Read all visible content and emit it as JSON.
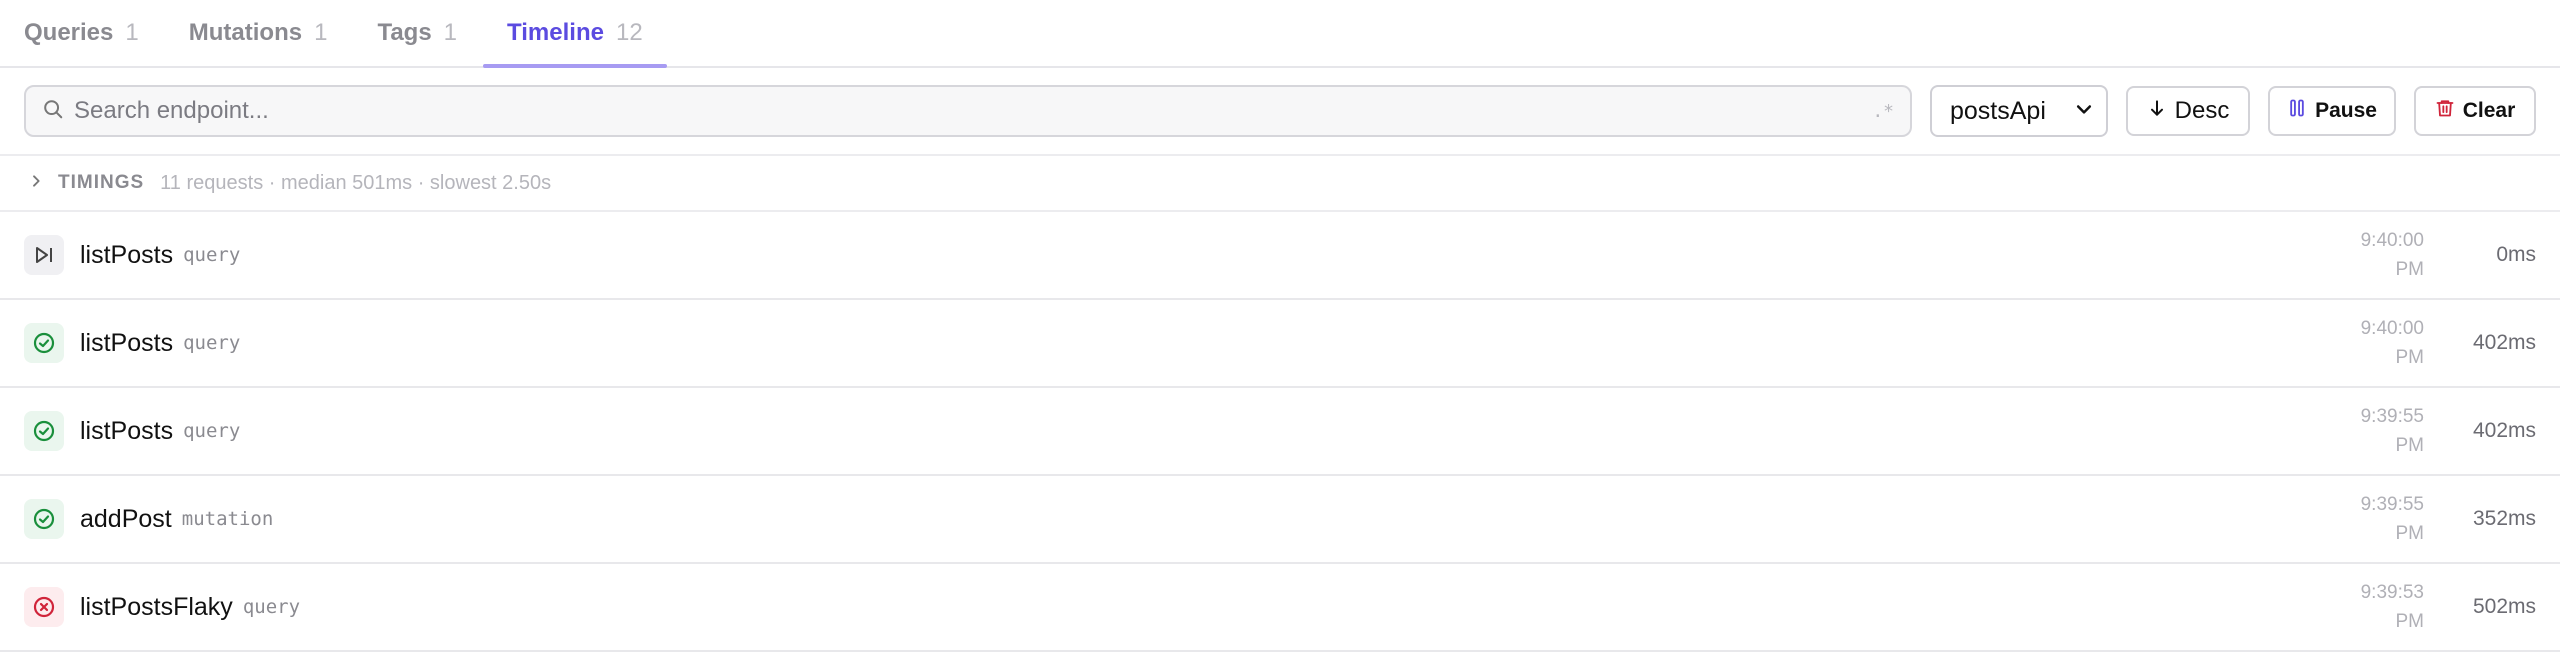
{
  "tabs": [
    {
      "label": "Queries",
      "count": "1"
    },
    {
      "label": "Mutations",
      "count": "1"
    },
    {
      "label": "Tags",
      "count": "1"
    },
    {
      "label": "Timeline",
      "count": "12",
      "active": true
    }
  ],
  "toolbar": {
    "search_placeholder": "Search endpoint...",
    "search_value": "",
    "regex_label": ".*",
    "api_select": "postsApi",
    "sort_label": "Desc",
    "pause_label": "Pause",
    "clear_label": "Clear"
  },
  "timings": {
    "label": "TIMINGS",
    "summary": "11 requests · median 501ms · slowest 2.50s"
  },
  "rows": [
    {
      "name": "listPosts",
      "type": "query",
      "time_line1": "9:40:00",
      "time_line2": "PM",
      "duration": "0ms",
      "status": "skip"
    },
    {
      "name": "listPosts",
      "type": "query",
      "time_line1": "9:40:00",
      "time_line2": "PM",
      "duration": "402ms",
      "status": "success"
    },
    {
      "name": "listPosts",
      "type": "query",
      "time_line1": "9:39:55",
      "time_line2": "PM",
      "duration": "402ms",
      "status": "success"
    },
    {
      "name": "addPost",
      "type": "mutation",
      "time_line1": "9:39:55",
      "time_line2": "PM",
      "duration": "352ms",
      "status": "success"
    },
    {
      "name": "listPostsFlaky",
      "type": "query",
      "time_line1": "9:39:53",
      "time_line2": "PM",
      "duration": "502ms",
      "status": "error"
    }
  ],
  "colors": {
    "accent": "#5b4be0",
    "success": "#1a8f3c",
    "error": "#d0243a",
    "muted": "#8a8a90"
  }
}
